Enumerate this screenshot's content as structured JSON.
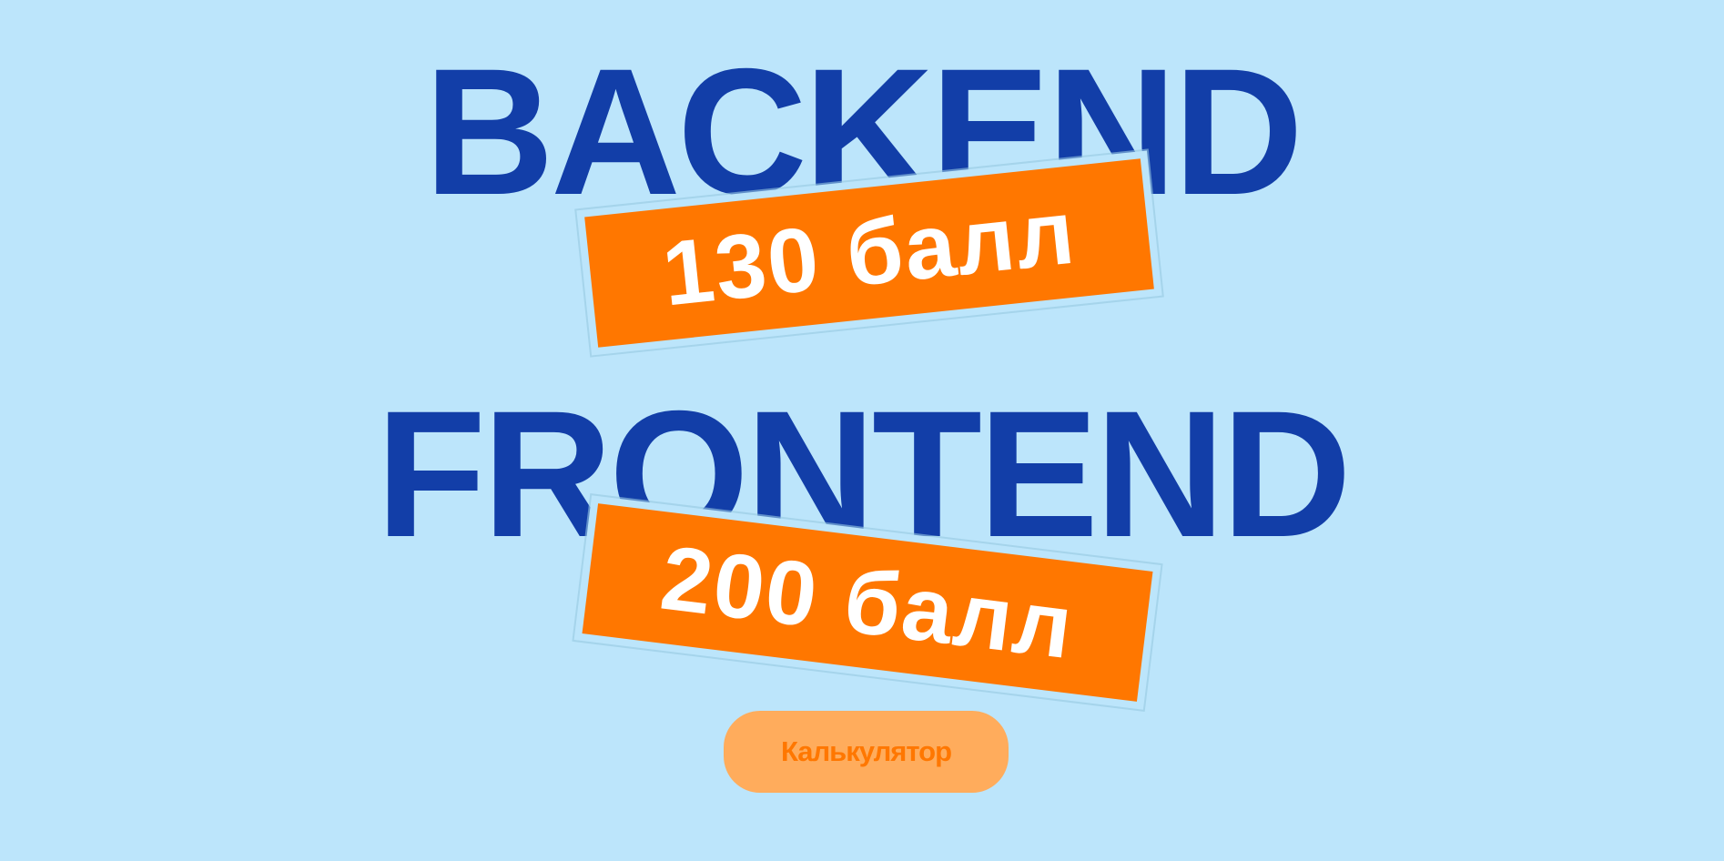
{
  "headings": {
    "backend": "BACKEND",
    "frontend": "FRONTEND"
  },
  "badges": {
    "backend_score": "130 балл",
    "frontend_score": "200 балл"
  },
  "calculator": {
    "label": "Калькулятор"
  },
  "colors": {
    "background": "#bce5fb",
    "heading": "#123ea8",
    "badge": "#ff7700",
    "badge_text": "#ffffff",
    "button_bg": "#ffac5c",
    "button_text": "#ff7700"
  }
}
